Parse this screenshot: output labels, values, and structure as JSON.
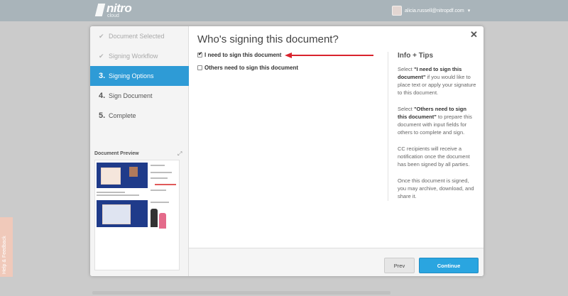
{
  "brand": {
    "name": "nitro",
    "sub": "cloud"
  },
  "user": {
    "email": "alicia.russell@nitropdf.com"
  },
  "help_tab": {
    "label": "Help & Feedback"
  },
  "steps": [
    {
      "label": "Document Selected",
      "state": "done"
    },
    {
      "label": "Signing Workflow",
      "state": "done"
    },
    {
      "number": "3.",
      "label": "Signing Options",
      "state": "active"
    },
    {
      "number": "4.",
      "label": "Sign Document",
      "state": "todo"
    },
    {
      "number": "5.",
      "label": "Complete",
      "state": "todo"
    }
  ],
  "preview": {
    "title": "Document Preview"
  },
  "dialog": {
    "title": "Who's signing this document?",
    "options": [
      {
        "label": "I need to sign this document",
        "checked": true
      },
      {
        "label": "Others need to sign this document",
        "checked": false
      }
    ]
  },
  "tips": {
    "title": "Info + Tips",
    "items": [
      {
        "pre": "Select ",
        "bold": "\"I need to sign this document\"",
        "post": " if you would like to place text or apply your signature to this document."
      },
      {
        "pre": "Select ",
        "bold": "\"Others need to sign this document\"",
        "post": " to prepare this document with input fields for others to complete and sign."
      },
      {
        "pre": "",
        "bold": "",
        "post": "CC recipients will receive a notification once the document has been signed by all parties."
      },
      {
        "pre": "",
        "bold": "",
        "post": "Once this document is signed, you may archive, download, and share it."
      }
    ]
  },
  "buttons": {
    "prev": "Prev",
    "continue": "Continue"
  },
  "colors": {
    "accent": "#2e9bd6",
    "continue": "#2aa5e0",
    "arrow": "#d9232d"
  },
  "icons": {
    "check": "✔",
    "close": "✕",
    "expand": "⤢",
    "caret": "▾"
  }
}
